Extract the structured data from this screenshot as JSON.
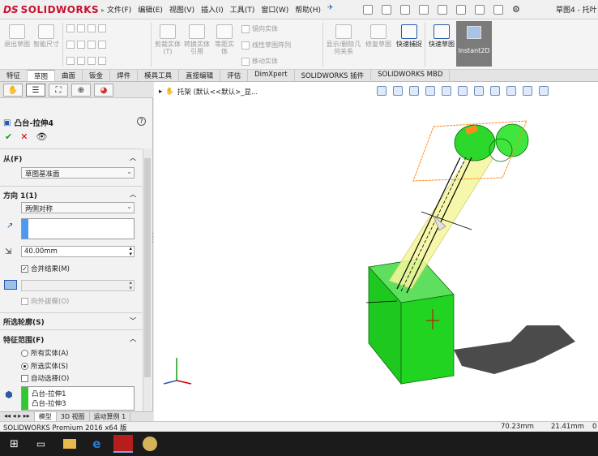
{
  "app": {
    "logo_ds": "DS",
    "logo_text": "SOLIDWORKS",
    "doc_title": "草图4 - 托叶"
  },
  "menu": [
    "文件(F)",
    "编辑(E)",
    "视图(V)",
    "插入(I)",
    "工具(T)",
    "窗口(W)",
    "帮助(H)"
  ],
  "ribbon": {
    "exit_sketch": "退出草图",
    "smart_dim": "智能尺寸",
    "cut_solid": "剪裁实体(T)",
    "convert_entities": "转换实体引用",
    "offset": "等距实体",
    "mirror": "镜向实体",
    "linear_pattern": "线性草图阵列",
    "move": "移动实体",
    "relations": "显示/删除几何关系",
    "repair": "修复草图",
    "quick_snap": "快速捕捉",
    "rapid_sketch": "快速草图",
    "instant2d": "Instant2D"
  },
  "tabs": [
    "特征",
    "草图",
    "曲面",
    "钣金",
    "焊件",
    "模具工具",
    "直接编辑",
    "评估",
    "DimXpert",
    "SOLIDWORKS 插件",
    "SOLIDWORKS MBD"
  ],
  "pm": {
    "title": "凸台-拉伸4",
    "help": "?",
    "from_label": "从(F)",
    "from_value": "草图基准面",
    "dir_label": "方向 1(1)",
    "dir_value": "两侧对称",
    "depth_value": "40.00mm",
    "merge_label": "合并结果(M)",
    "draft_label": "向外拔模(O)",
    "contours_label": "所选轮廓(S)",
    "scope_label": "特征范围(F)",
    "all_bodies": "所有实体(A)",
    "selected_bodies": "所选实体(S)",
    "auto_select": "自动选择(O)",
    "bodies": [
      "凸台-拉伸1",
      "凸台-拉伸3"
    ]
  },
  "bottom_tabs": [
    "模型",
    "3D 视图",
    "运动算例 1"
  ],
  "status": {
    "product": "SOLIDWORKS Premium 2016 x64 版",
    "x": "70.23mm",
    "y": "21.41mm",
    "z": "0"
  },
  "viewport": {
    "breadcrumb": "托架 (默认<<默认>_显..."
  },
  "colors": {
    "brand": "#c8102e",
    "body_green": "#1ed21e",
    "preview_yellow": "#f2f29a",
    "sketch_orange": "#ff8c1a"
  }
}
